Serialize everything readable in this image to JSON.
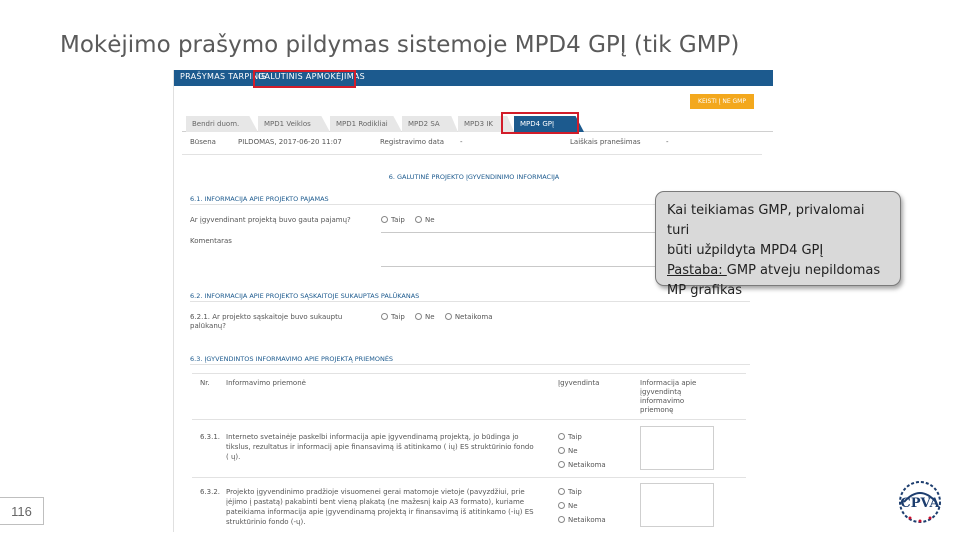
{
  "slide": {
    "title": "Mokėjimo prašymo pildymas sistemoje MPD4 GPĮ (tik GMP)",
    "page_number": "116"
  },
  "app": {
    "top_nav": [
      "PRAŠYMAS TARPINIS",
      "GALUTINIS APMOKĖJIMAS"
    ],
    "action_button": "KEISTI Į NE GMP",
    "tabs": [
      "Bendri duom.",
      "MPD1 Veiklos",
      "MPD1 Rodikliai",
      "MPD2 SA",
      "MPD3 IK",
      "MPD4 GPĮ"
    ],
    "status_row": {
      "status_label": "Būsena",
      "status_value": "PILDOMAS, 2017-06-20 11:07",
      "reg_label": "Registravimo data",
      "reg_value": "-",
      "msg_label": "Laiškais pranešimas",
      "msg_value": "-"
    },
    "main_section": "6. GALUTINĖ PROJEKTO ĮGYVENDINIMO INFORMACIJA",
    "section_61": {
      "title": "6.1. INFORMACIJA APIE PROJEKTO PAJAMAS",
      "question": "Ar įgyvendinant projektą buvo gauta pajamų?",
      "options": [
        "Taip",
        "Ne"
      ],
      "comment_label": "Komentaras"
    },
    "section_62": {
      "title": "6.2. INFORMACIJA APIE PROJEKTO SĄSKAITOJE SUKAUPTAS PALŪKANAS",
      "question": "6.2.1. Ar projekto sąskaitoje buvo sukauptu palūkanų?",
      "options": [
        "Taip",
        "Ne",
        "Netaikoma"
      ]
    },
    "section_63": {
      "title": "6.3. ĮGYVENDINTOS INFORMAVIMO APIE PROJEKTĄ PRIEMONĖS",
      "headers": {
        "nr": "Nr.",
        "measure": "Informavimo priemonė",
        "implemented": "Įgyvendinta",
        "info": "Informacija apie įgyvendintą informavimo priemonę"
      },
      "rows": [
        {
          "nr": "6.3.1.",
          "text": "Interneto svetainėje paskelbi informacija apie įgyvendinamą projektą, jo būdinga jo tikslus, rezultatus ir informacij apie finansavimą iš atitinkamo ( ių) ES struktūrinio fondo ( ų).",
          "options": [
            "Taip",
            "Ne",
            "Netaikoma"
          ]
        },
        {
          "nr": "6.3.2.",
          "text": "Projekto įgyvendinimo pradžioje visuomenei gerai matomoje vietoje (pavyzdžiui, prie įėjimo į pastatą) pakabinti bent vieną plakatą (ne mažesnį kaip A3 formato), kuriame pateikiama informacija apie įgyvendinamą projektą ir finansavimą iš atitinkamo (-ių) ES struktūrinio fondo (-ų).",
          "options": [
            "Taip",
            "Ne",
            "Netaikoma"
          ]
        }
      ]
    }
  },
  "callout": {
    "line1": "Kai teikiamas GMP, privalomai turi",
    "line2": "būti užpildyta MPD4 GPĮ",
    "note_label": "Pastaba: ",
    "note_text": "GMP atveju nepildomas",
    "line4": "MP grafikas"
  },
  "colors": {
    "nav_blue": "#1c5a8e",
    "highlight_red": "#d21d2a",
    "button_orange": "#f3a81d"
  },
  "icons": [
    "cpva-logo"
  ]
}
